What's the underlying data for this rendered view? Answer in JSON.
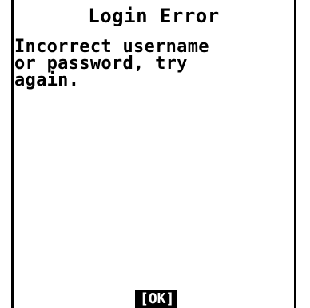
{
  "dialog": {
    "title": "Login Error",
    "message": "Incorrect username\nor password, try\nagain."
  },
  "softkeys": {
    "center_label": "[OK]"
  }
}
